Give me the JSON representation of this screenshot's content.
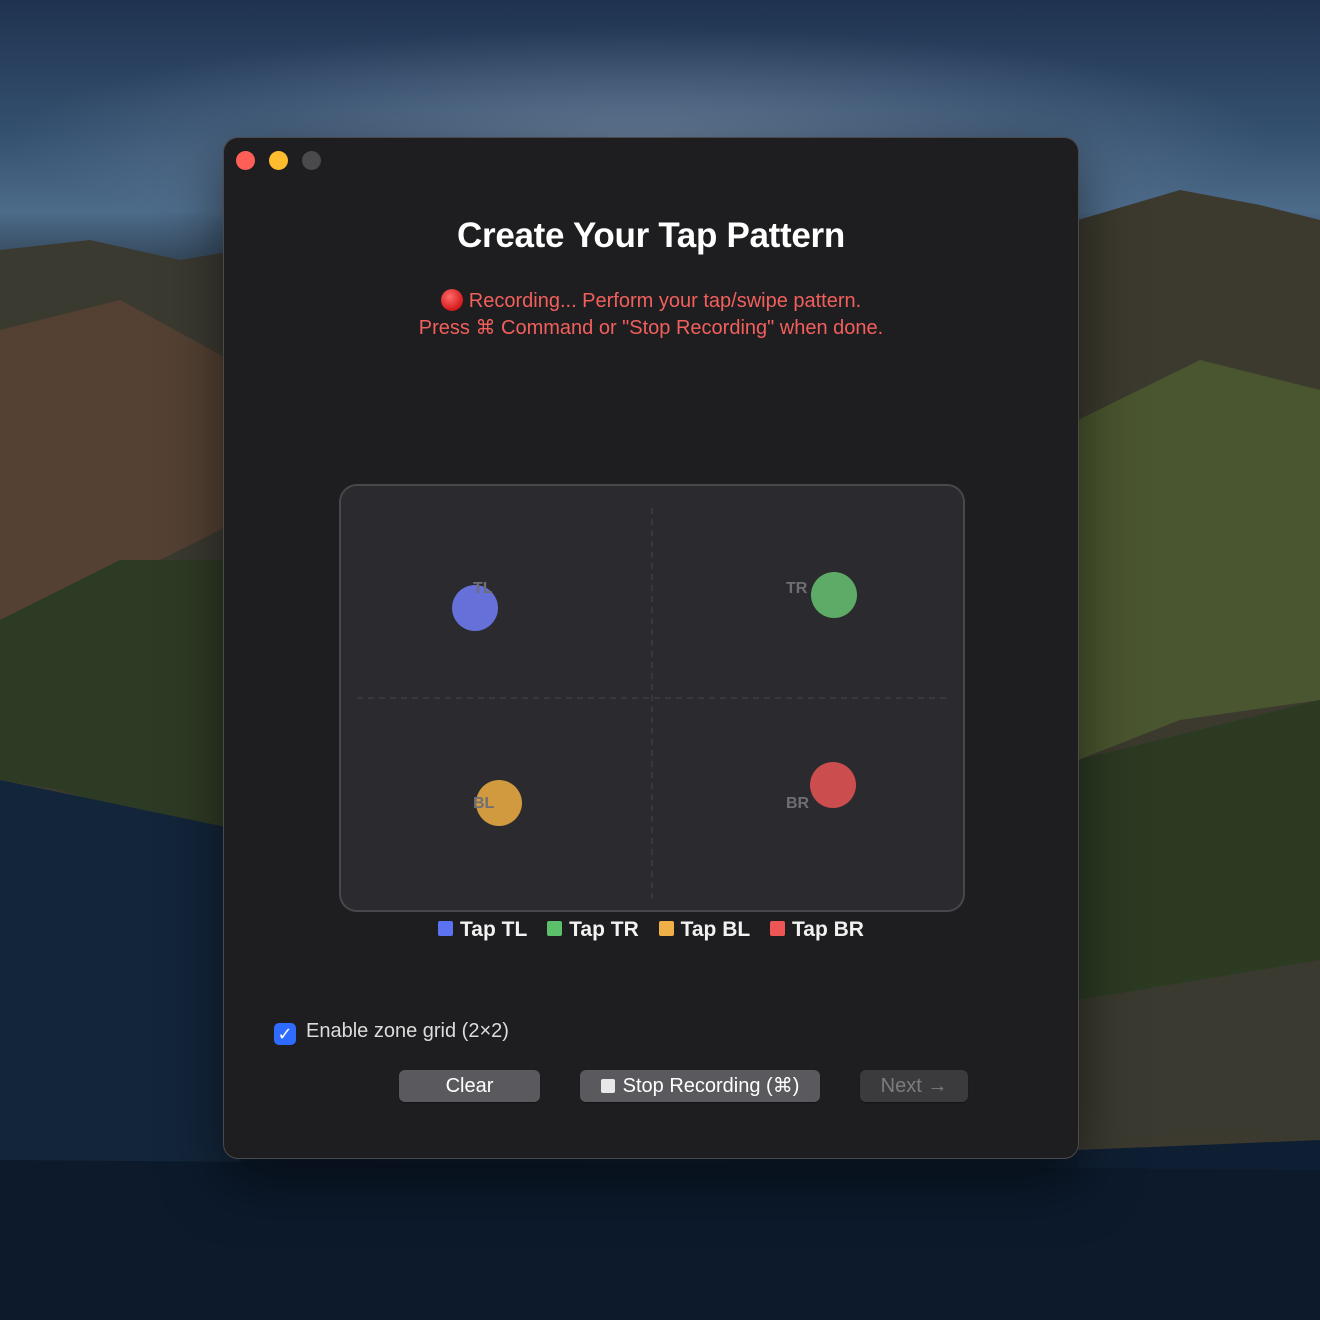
{
  "window": {
    "title": "Create Your Tap Pattern",
    "status_line1": "Recording... Perform your tap/swipe pattern.",
    "status_line2": "Press ⌘ Command or \"Stop Recording\" when done."
  },
  "pad": {
    "zones": [
      {
        "id": "TL",
        "label": "TL",
        "color": "#6570d8"
      },
      {
        "id": "TR",
        "label": "TR",
        "color": "#5dab66"
      },
      {
        "id": "BL",
        "label": "BL",
        "color": "#d29a3f"
      },
      {
        "id": "BR",
        "label": "BR",
        "color": "#cc4d4d"
      }
    ]
  },
  "legend": {
    "items": [
      {
        "label": "Tap TL",
        "color": "#5b73f0"
      },
      {
        "label": "Tap TR",
        "color": "#5cc06a"
      },
      {
        "label": "Tap BL",
        "color": "#f0b048"
      },
      {
        "label": "Tap BR",
        "color": "#ee5656"
      }
    ]
  },
  "options": {
    "zone_grid_label": "Enable zone grid (2×2)",
    "zone_grid_checked": true,
    "check_glyph": "✓"
  },
  "buttons": {
    "clear": "Clear",
    "stop": "Stop Recording (⌘)",
    "next": "Next →"
  },
  "icons": {
    "recording": "recording-dot-icon",
    "stop": "stop-square-icon",
    "check": "checkmark-icon"
  }
}
